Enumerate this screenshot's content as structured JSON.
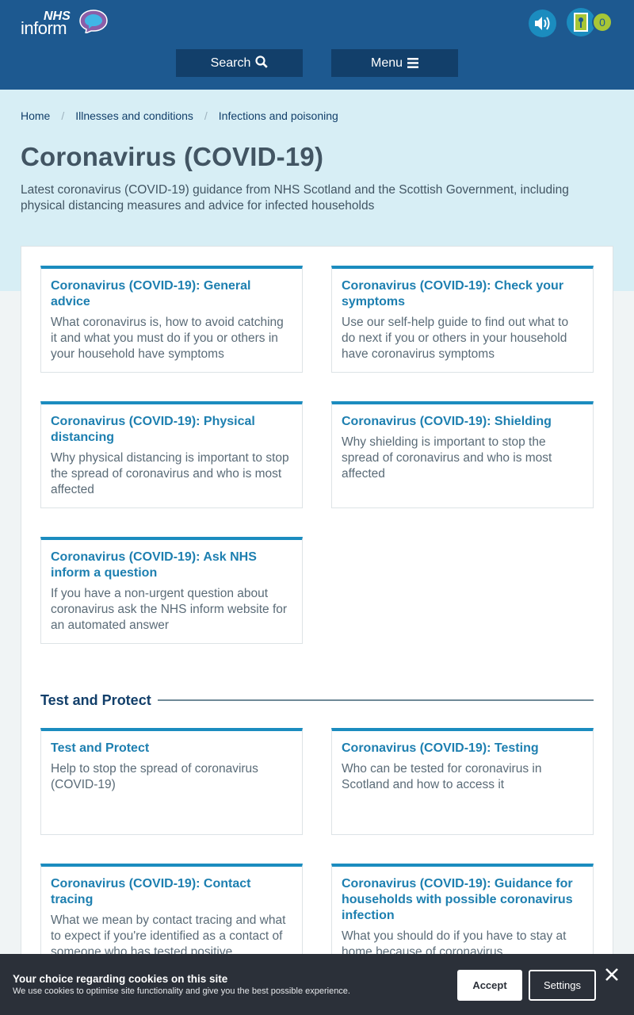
{
  "header": {
    "logo_top": "NHS",
    "logo_bottom": "inform",
    "docs_count": "0",
    "search_label": "Search",
    "menu_label": "Menu"
  },
  "breadcrumb": [
    "Home",
    "Illnesses and conditions",
    "Infections and poisoning"
  ],
  "page": {
    "title": "Coronavirus (COVID-19)",
    "intro": "Latest coronavirus (COVID-19) guidance from NHS Scotland and the Scottish Government, including physical distancing measures and advice for infected households"
  },
  "cards": [
    {
      "title": "Coronavirus (COVID-19): General advice",
      "desc": "What coronavirus is, how to avoid catching it and what you must do if you or others in your household have symptoms"
    },
    {
      "title": "Coronavirus (COVID-19): Check your symptoms",
      "desc": "Use our self-help guide to find out what to do next if you or others in your household have coronavirus symptoms"
    },
    {
      "title": "Coronavirus (COVID-19): Physical distancing",
      "desc": "Why physical distancing is important to stop the spread of coronavirus and who is most affected"
    },
    {
      "title": "Coronavirus (COVID-19): Shielding",
      "desc": "Why shielding is important to stop the spread of coronavirus and who is most affected"
    },
    {
      "title": "Coronavirus (COVID-19): Ask NHS inform a question",
      "desc": "If you have a non-urgent question about coronavirus ask the NHS inform website for an automated answer"
    }
  ],
  "section": {
    "heading": "Test and Protect",
    "cards": [
      {
        "title": "Test and Protect",
        "desc": "Help to stop the spread of coronavirus (COVID-19)"
      },
      {
        "title": "Coronavirus (COVID-19): Testing",
        "desc": "Who can be tested for coronavirus in Scotland and how to access it"
      },
      {
        "title": "Coronavirus (COVID-19): Contact tracing",
        "desc": "What we mean by contact tracing and what to expect if you're identified as a contact of someone who has tested positive"
      },
      {
        "title": "Coronavirus (COVID-19): Guidance for households with possible coronavirus infection",
        "desc": "What you should do if you have to stay at home because of coronavirus"
      }
    ]
  },
  "cookie": {
    "title": "Your choice regarding cookies on this site",
    "text": "We use cookies to optimise site functionality and give you the best possible experience.",
    "accept": "Accept",
    "settings": "Settings"
  },
  "colors": {
    "header": "#1d5990",
    "hero": "#d7eef5",
    "accent": "#1b8cbf",
    "badge": "#a7c636",
    "cookie_bg": "#2b3039"
  }
}
